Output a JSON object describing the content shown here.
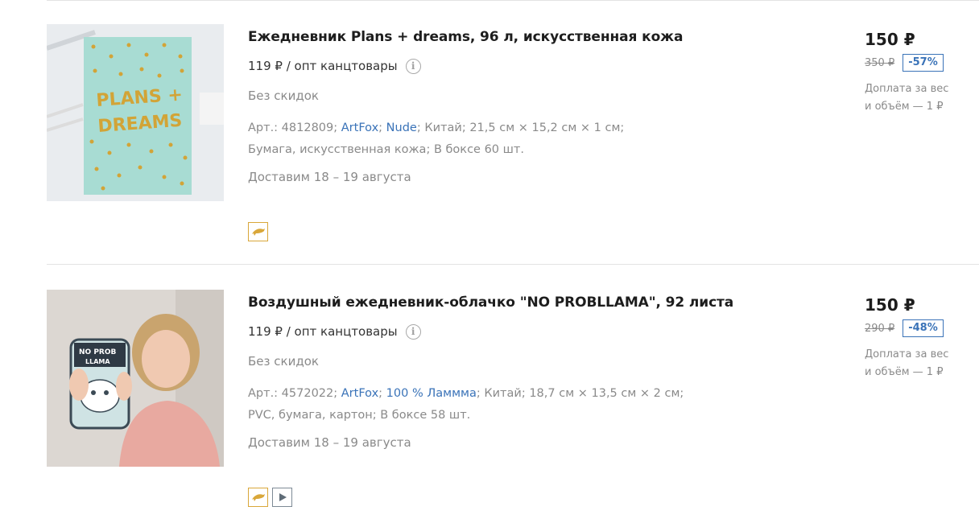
{
  "products": [
    {
      "title": "Ежедневник Plans + dreams, 96 л, искусственная кожа",
      "wholesale_price": "119 ₽ / опт канцтовары",
      "no_discount": "Без скидок",
      "art": "Арт.: 4812809",
      "brand": "ArtFox",
      "series": "Nude",
      "country": "Китай",
      "dimensions": "21,5 см × 15,2 см × 1 см",
      "material": "Бумага, искусственная кожа",
      "box": "В боксе 60 шт.",
      "delivery": "Доставим 18 – 19 августа",
      "price": "150 ₽",
      "old_price": "350 ₽",
      "discount": "-57%",
      "surcharge": "Доплата за вес и объём — 1 ₽",
      "cover_text_1": "PLANS +",
      "cover_text_2": "DREAMS",
      "badges": [
        "dolphin-icon"
      ]
    },
    {
      "title": "Воздушный ежедневник-облачко \"NO PROBLLAMA\", 92 листа",
      "wholesale_price": "119 ₽ / опт канцтовары",
      "no_discount": "Без скидок",
      "art": "Арт.: 4572022",
      "brand": "ArtFox",
      "series": "100 % Ламмма",
      "country": "Китай",
      "dimensions": "18,7 см × 13,5 см × 2 см",
      "material": "PVC, бумага, картон",
      "box": "В боксе 58 шт.",
      "delivery": "Доставим 18 – 19 августа",
      "price": "150 ₽",
      "old_price": "290 ₽",
      "discount": "-48%",
      "surcharge": "Доплата за вес и объём — 1 ₽",
      "cover_text_1": "NO PROB",
      "cover_text_2": "LLAMA",
      "badges": [
        "dolphin-icon",
        "play-icon"
      ]
    }
  ],
  "colors": {
    "link": "#3a73b8",
    "badge_border": "#d9a73a",
    "muted_text": "#8a8a8a"
  }
}
